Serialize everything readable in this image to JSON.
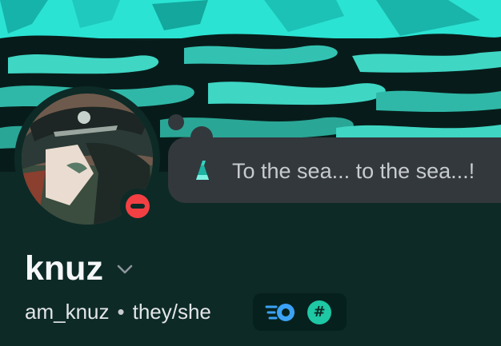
{
  "banner": {
    "description_icon": "stormy-sea-art",
    "accent": "#2ee6d6",
    "dark": "#0b2422"
  },
  "profile": {
    "status_icon": "do-not-disturb-icon",
    "status_color": "#f23f43",
    "custom_status": {
      "emoji": "flask-icon",
      "text": "To the sea... to the sea...!"
    },
    "display_name": "knuz",
    "username": "am_knuz",
    "separator": "•",
    "pronouns": "they/she",
    "badges": [
      {
        "icon": "nitro-boost-icon",
        "color": "#3ba2f5"
      },
      {
        "icon": "hashtag-badge-icon",
        "label": "#",
        "color": "#1ec8a5"
      }
    ]
  }
}
